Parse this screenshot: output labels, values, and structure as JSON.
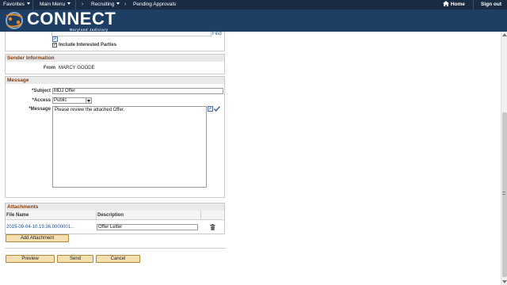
{
  "nav": {
    "favorites": "Favorites",
    "main_menu": "Main Menu",
    "crumb1": "Recruiting",
    "crumb2": "Pending Approvals",
    "home": "Home",
    "sign_out": "Sign out"
  },
  "brand": {
    "name": "CONNECT",
    "sub": "Maryland Judiciary"
  },
  "top": {
    "find_link": "Find",
    "include_interested_label": "Include Interested Parties",
    "include_interested_checked": true
  },
  "sender": {
    "title": "Sender Information",
    "from_label": "From",
    "from_value": "MARCY GOODE"
  },
  "message": {
    "title": "Message",
    "subject_label": "*Subject",
    "subject_value": "MDJ Offer",
    "access_label": "*Access",
    "access_value": "Public",
    "message_label": "*Message",
    "message_value": "Please review the attached Offer."
  },
  "attachments": {
    "title": "Attachments",
    "col_file_name": "File Name",
    "col_description": "Description",
    "rows": [
      {
        "file_name": "2015-09-04-10.19.36.0000001...",
        "description": "Offer Letter"
      }
    ],
    "add_button": "Add Attachment"
  },
  "actions": {
    "preview": "Preview",
    "send": "Send",
    "cancel": "Cancel"
  },
  "colors": {
    "nav_bg": "#1a2c44",
    "banner_bg": "#1e3f63",
    "section_title": "#8a3b0a",
    "button_bg": "#f5deb0",
    "link": "#1f4e99"
  }
}
